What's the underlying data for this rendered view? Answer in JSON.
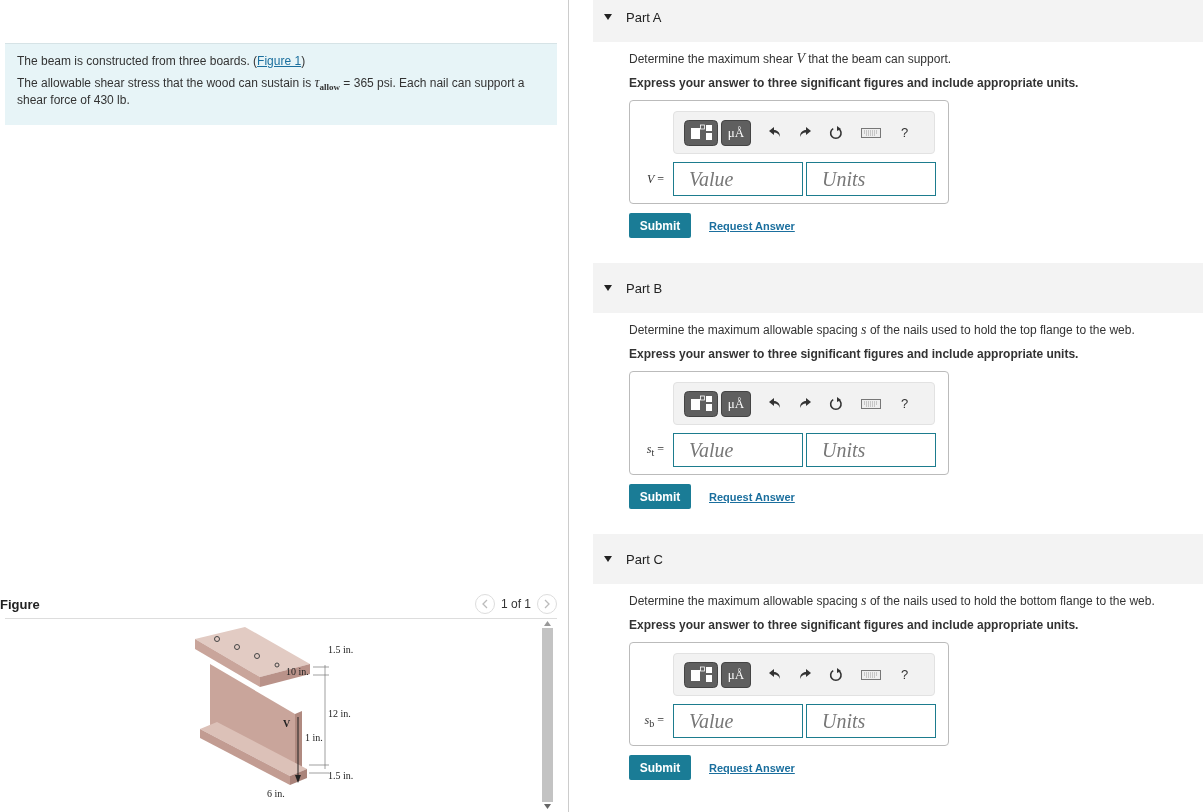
{
  "problem": {
    "intro": "The beam is constructed from three boards. (",
    "figure_link": "Figure 1",
    "intro_end": ")",
    "statement": "The allowable shear stress that the wood can sustain is *τ*$_{allow}$ = 365 psi. Each nail can support a shear force of 430 lb."
  },
  "figure": {
    "title": "Figure",
    "pager": "1 of 1",
    "labels": {
      "top_flange": "1.5 in.",
      "flange_width": "10 in.",
      "web_height": "12 in.",
      "shear": "V",
      "web_thickness": "1 in.",
      "bottom_flange": "1.5 in.",
      "bottom_width": "6 in."
    }
  },
  "parts": [
    {
      "title": "Part A",
      "expanded": true,
      "units_button": "μÅ",
      "help": "?",
      "question": "Determine the maximum shear *V* that the beam can support.",
      "instruction": "Express your answer to three significant figures and include appropriate units.",
      "variable": "*V* =",
      "value_placeholder": "Value",
      "units_placeholder": "Units",
      "submit": "Submit",
      "request": "Request Answer"
    },
    {
      "title": "Part B",
      "expanded": true,
      "units_button": "μÅ",
      "help": "?",
      "question": "Determine the maximum allowable spacing *s* of the nails used to hold the top flange to the web.",
      "instruction": "Express your answer to three significant figures and include appropriate units.",
      "variable": "*s*$_{t}$ =",
      "value_placeholder": "Value",
      "units_placeholder": "Units",
      "submit": "Submit",
      "request": "Request Answer"
    },
    {
      "title": "Part C",
      "expanded": true,
      "units_button": "μÅ",
      "help": "?",
      "question": "Determine the maximum allowable spacing *s* of the nails used to hold the bottom flange to the web.",
      "instruction": "Express your answer to three significant figures and include appropriate units.",
      "variable": "*s*$_{b}$ =",
      "value_placeholder": "Value",
      "units_placeholder": "Units",
      "submit": "Submit",
      "request": "Request Answer"
    }
  ]
}
